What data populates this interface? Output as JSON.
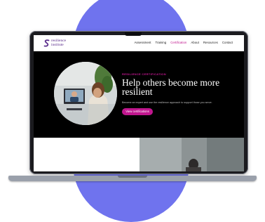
{
  "brand": {
    "logo_line1": "resilience",
    "logo_line2": "institute"
  },
  "nav": {
    "items": [
      {
        "label": "Assessment",
        "active": false
      },
      {
        "label": "Training",
        "active": false
      },
      {
        "label": "Certification",
        "active": true
      },
      {
        "label": "About",
        "active": false
      },
      {
        "label": "Resources",
        "active": false
      },
      {
        "label": "Contact",
        "active": false
      }
    ]
  },
  "hero": {
    "eyebrow": "RESILIENCE CERTIFICATION",
    "headline": "Help others become more resilient",
    "subtext": "Become an expert and use the resilience approach to support those you serve.",
    "cta_label": "View certifications"
  },
  "colors": {
    "accent": "#c0168e",
    "backdrop_circle": "#6f73ee",
    "logo_purple": "#5a2c8c",
    "screen_bg": "#000000"
  },
  "icons": {
    "logo_mark": "resilience-s-logo-icon"
  }
}
